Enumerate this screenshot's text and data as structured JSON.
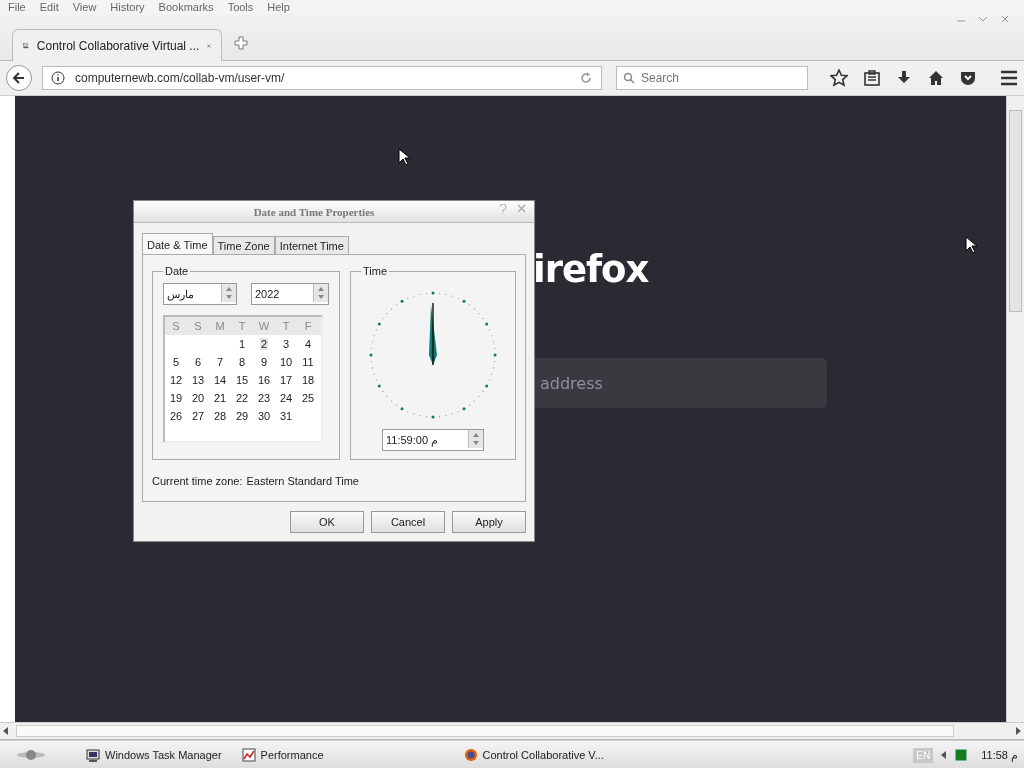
{
  "menu_bar": [
    "File",
    "Edit",
    "View",
    "History",
    "Bookmarks",
    "Tools",
    "Help"
  ],
  "tabs": [
    {
      "label": "Control Collaborative Virtual ...",
      "selected": true
    }
  ],
  "address_bar": {
    "value": "computernewb.com/collab-vm/user-vm/"
  },
  "search": {
    "placeholder": "Search"
  },
  "vm_screen": {
    "heading": "irefox",
    "field_placeholder": "address"
  },
  "dialog": {
    "title": "Date and Time Properties",
    "tabs": [
      {
        "label": "Date & Time",
        "selected": true
      },
      {
        "label": "Time Zone",
        "selected": false
      },
      {
        "label": "Internet Time",
        "selected": false
      }
    ],
    "date_group": "Date",
    "month": "مارس",
    "year": "2022",
    "weekdays": [
      "S",
      "S",
      "M",
      "T",
      "W",
      "T",
      "F"
    ],
    "weeks": [
      {
        "days": [
          {
            "label": "1",
            "selected": false
          },
          {
            "label": "2",
            "selected": true
          },
          {
            "label": "3",
            "selected": false
          },
          {
            "label": "4",
            "selected": false
          }
        ]
      },
      {
        "days": [
          {
            "label": "5",
            "selected": false
          },
          {
            "label": "6",
            "selected": false
          },
          {
            "label": "7",
            "selected": false
          },
          {
            "label": "8",
            "selected": false
          },
          {
            "label": "9",
            "selected": false
          },
          {
            "label": "10",
            "selected": false
          },
          {
            "label": "11",
            "selected": false
          }
        ]
      },
      {
        "days": [
          {
            "label": "12",
            "selected": false
          },
          {
            "label": "13",
            "selected": false
          },
          {
            "label": "14",
            "selected": false
          },
          {
            "label": "15",
            "selected": false
          },
          {
            "label": "16",
            "selected": false
          },
          {
            "label": "17",
            "selected": false
          },
          {
            "label": "18",
            "selected": false
          }
        ]
      },
      {
        "days": [
          {
            "label": "19",
            "selected": false
          },
          {
            "label": "20",
            "selected": false
          },
          {
            "label": "21",
            "selected": false
          },
          {
            "label": "22",
            "selected": false
          },
          {
            "label": "23",
            "selected": false
          },
          {
            "label": "24",
            "selected": false
          },
          {
            "label": "25",
            "selected": false
          }
        ]
      },
      {
        "days": [
          {
            "label": "26",
            "selected": false
          },
          {
            "label": "27",
            "selected": false
          },
          {
            "label": "28",
            "selected": false
          },
          {
            "label": "29",
            "selected": false
          },
          {
            "label": "30",
            "selected": false
          },
          {
            "label": "31",
            "selected": false
          }
        ]
      }
    ],
    "time_group": "Time",
    "time": "11:59:00 م",
    "time_zone_label": "Current time zone:",
    "time_zone": "Eastern Standard Time",
    "buttons": [
      "OK",
      "Cancel",
      "Apply"
    ]
  },
  "taskbar": {
    "items": [
      "Windows Task Manager",
      "Performance",
      "Control Collaborative V..."
    ],
    "language": "EN",
    "clock": "11:58 م"
  }
}
